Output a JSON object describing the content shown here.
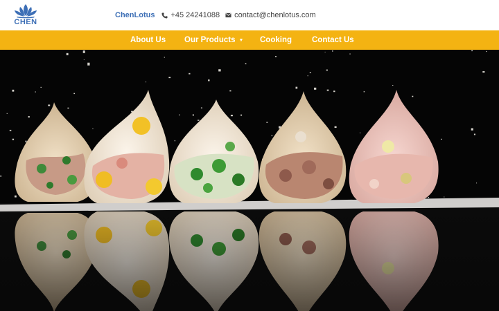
{
  "header": {
    "logo_text": "CHEN",
    "brand": "ChenLotus",
    "phone": "+45 24241088",
    "email": "contact@chenlotus.com",
    "phone_icon": "phone-icon",
    "email_icon": "envelope-icon"
  },
  "nav": {
    "items": [
      {
        "label": "About Us"
      },
      {
        "label": "Our Products",
        "has_dropdown": true
      },
      {
        "label": "Cooking"
      },
      {
        "label": "Contact Us"
      }
    ]
  },
  "colors": {
    "brand_blue": "#3d6fb6",
    "nav_bg": "#f4b312",
    "nav_text": "#ffffff",
    "hero_bg": "#050505"
  },
  "hero": {
    "image": "photo of five raw dumplings with colourful fillings on a black reflective surface with flour dust"
  }
}
